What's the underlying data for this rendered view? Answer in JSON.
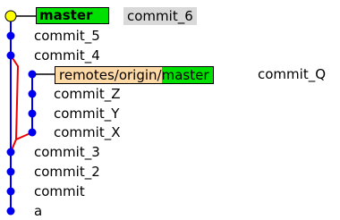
{
  "head": {
    "branch": "master",
    "subject": "commit_6"
  },
  "remote_ref": {
    "remote": "remotes/origin/",
    "branch": "master",
    "subject": "commit_Q"
  },
  "commits": [
    {
      "subject": "commit_5"
    },
    {
      "subject": "commit_4"
    },
    {
      "subject": "commit_Z"
    },
    {
      "subject": "commit_Y"
    },
    {
      "subject": "commit_X"
    },
    {
      "subject": "commit_3"
    },
    {
      "subject": "commit_2"
    },
    {
      "subject": "commit"
    },
    {
      "subject": "a"
    }
  ],
  "colors": {
    "head_dot": "#ffff00",
    "node": "#0000ee",
    "main_line": "#0000ee",
    "branch_line": "#ee0000",
    "head_link": "#000000",
    "local_branch_tag": "#00e000",
    "remote_prefix_tag": "#ffd9a6",
    "head_subject_highlight": "#d9d9d9"
  }
}
